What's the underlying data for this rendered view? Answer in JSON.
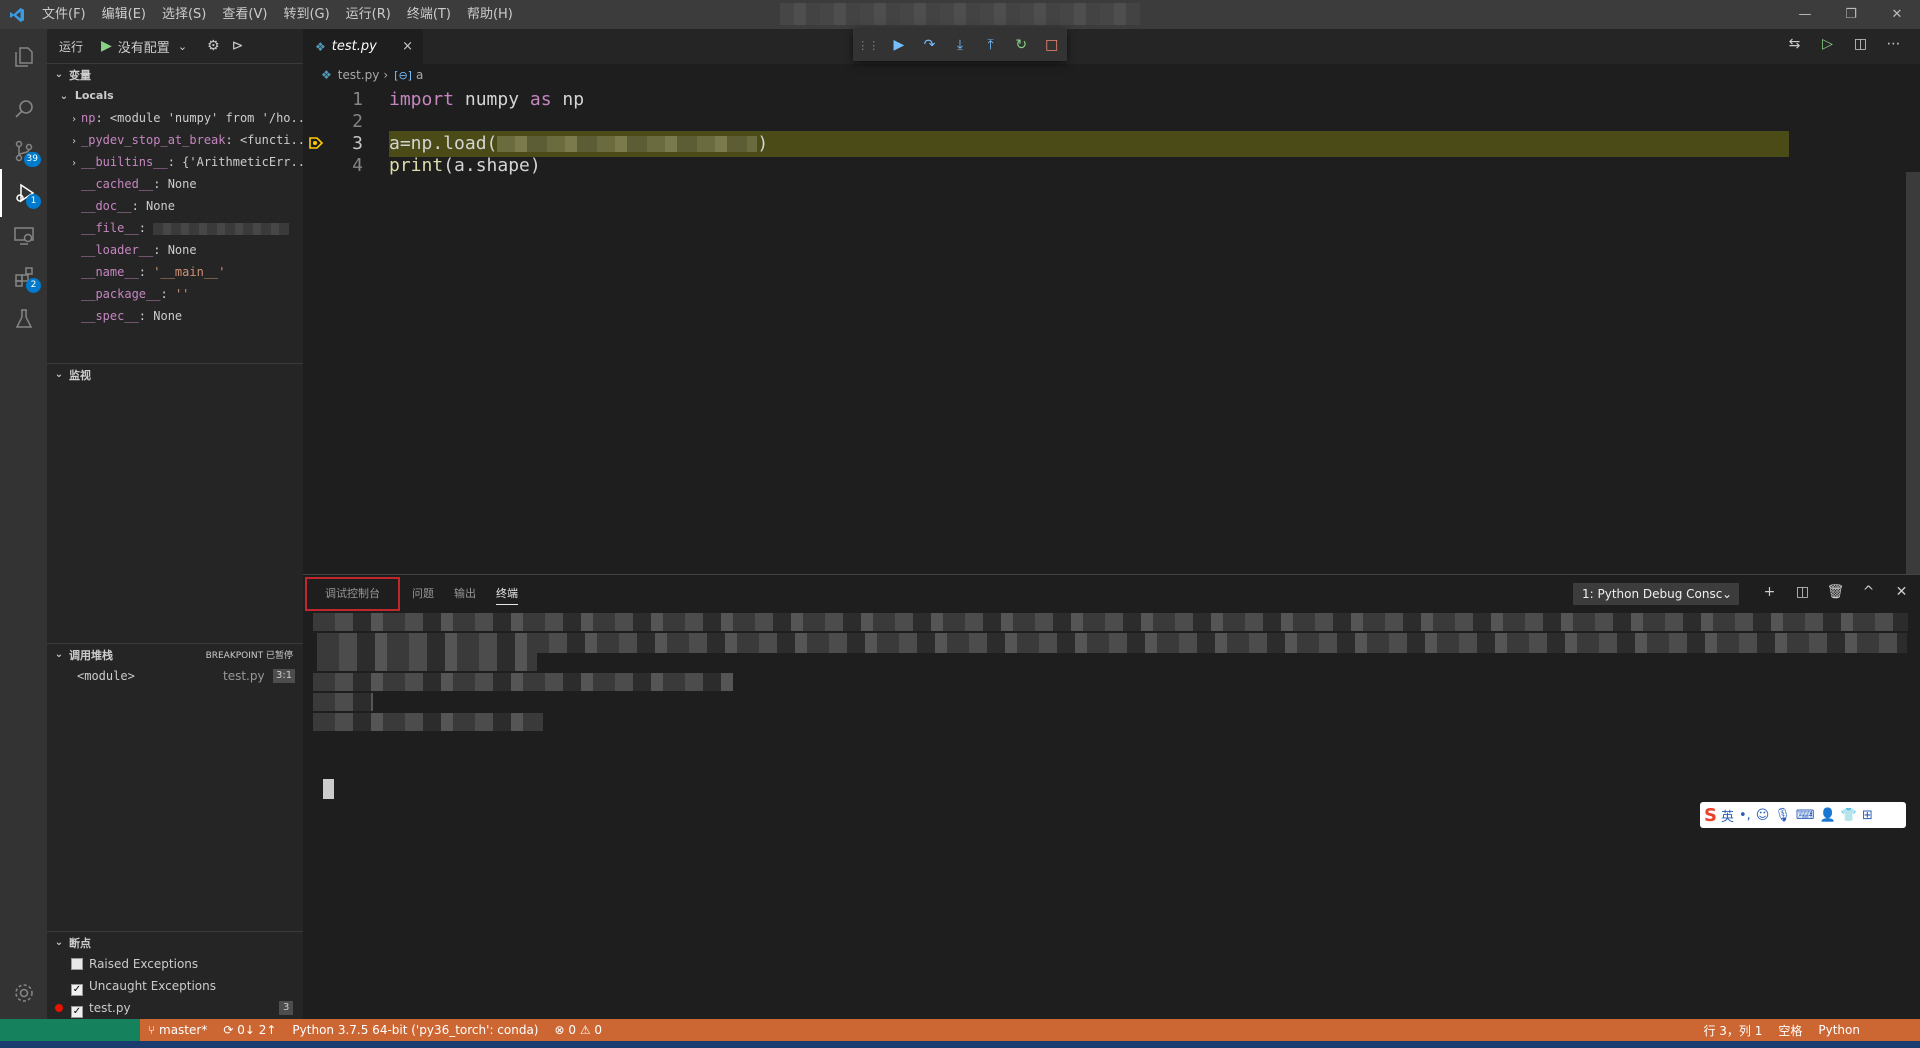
{
  "titlebar": {
    "menu": [
      "文件(F)",
      "编辑(E)",
      "选择(S)",
      "查看(V)",
      "转到(G)",
      "运行(R)",
      "终端(T)",
      "帮助(H)"
    ],
    "controls": [
      "—",
      "❐",
      "✕"
    ]
  },
  "activity_bar": {
    "items": [
      {
        "name": "explorer-icon",
        "glyph": "⧉"
      },
      {
        "name": "search-icon",
        "glyph": "⚲"
      },
      {
        "name": "source-control-icon",
        "glyph": "⑂",
        "badge": "39"
      },
      {
        "name": "run-debug-icon",
        "glyph": "▷",
        "badge": "1"
      },
      {
        "name": "remote-explorer-icon",
        "glyph": "⊡"
      },
      {
        "name": "extensions-icon",
        "glyph": "⊞",
        "badge": "2"
      },
      {
        "name": "testing-icon",
        "glyph": "⚗"
      }
    ],
    "manage_icon": "⚙"
  },
  "sidebar": {
    "run_label": "运行",
    "config_label": "没有配置",
    "variables": {
      "title": "变量",
      "locals_title": "Locals",
      "items": [
        {
          "expandable": true,
          "name": "np",
          "value": "<module 'numpy' from '/ho..."
        },
        {
          "expandable": true,
          "name": "_pydev_stop_at_break",
          "value": "<functi..."
        },
        {
          "expandable": true,
          "name": "__builtins__",
          "value": "{'ArithmeticErr..."
        },
        {
          "expandable": false,
          "name": "__cached__",
          "value": "None"
        },
        {
          "expandable": false,
          "name": "__doc__",
          "value": "None"
        },
        {
          "expandable": false,
          "name": "__file__",
          "value": ""
        },
        {
          "expandable": false,
          "name": "__loader__",
          "value": "None"
        },
        {
          "expandable": false,
          "name": "__name__",
          "value": "'__main__'"
        },
        {
          "expandable": false,
          "name": "__package__",
          "value": "''"
        },
        {
          "expandable": false,
          "name": "__spec__",
          "value": "None"
        }
      ]
    },
    "watch": {
      "title": "监视"
    },
    "call_stack": {
      "title": "调用堆栈",
      "status": "BREAKPOINT 已暂停",
      "frames": [
        {
          "name": "<module>",
          "file": "test.py",
          "pos": "3:1"
        }
      ]
    },
    "breakpoints": {
      "title": "断点",
      "items": [
        {
          "label": "Raised Exceptions",
          "checked": false
        },
        {
          "label": "Uncaught Exceptions",
          "checked": true
        },
        {
          "label": "test.py",
          "checked": true,
          "count": "3"
        }
      ]
    }
  },
  "editor": {
    "tab": {
      "label": "test.py",
      "close": "×"
    },
    "breadcrumb": {
      "file": "test.py",
      "symbol": "a"
    },
    "debug_toolbar": [
      "⋮⋮",
      "▶",
      "↷",
      "⤓",
      "⤒",
      "↻",
      "□"
    ],
    "actions": [
      "⇆",
      "▷",
      "◫",
      "⋯"
    ],
    "lines": [
      {
        "num": "1",
        "kw1": "import",
        "mid": " numpy ",
        "kw2": "as",
        "end": " np"
      },
      {
        "num": "2"
      },
      {
        "num": "3",
        "code": "a=np.load(",
        "tail": ")"
      },
      {
        "num": "4",
        "fn": "print",
        "rest": "(a.shape)"
      }
    ]
  },
  "panel": {
    "tabs": [
      "调试控制台",
      "问题",
      "输出",
      "终端"
    ],
    "terminal_select": "1: Python Debug Consc",
    "actions": [
      "+",
      "◫",
      "🗑",
      "^",
      "✕"
    ]
  },
  "ime": {
    "brand": "S",
    "lang": "英"
  },
  "status_bar": {
    "branch": "master*",
    "sync": "0↓ 2↑",
    "interpreter": "Python 3.7.5 64-bit ('py36_torch': conda)",
    "problems": "⊗ 0 ⚠ 0",
    "position": "行 3，列 1",
    "indent": "空格",
    "lang": "Python"
  },
  "colors": {
    "accent": "#007acc",
    "status": "#cc6633",
    "breakpoint_line": "#4b4b18"
  }
}
